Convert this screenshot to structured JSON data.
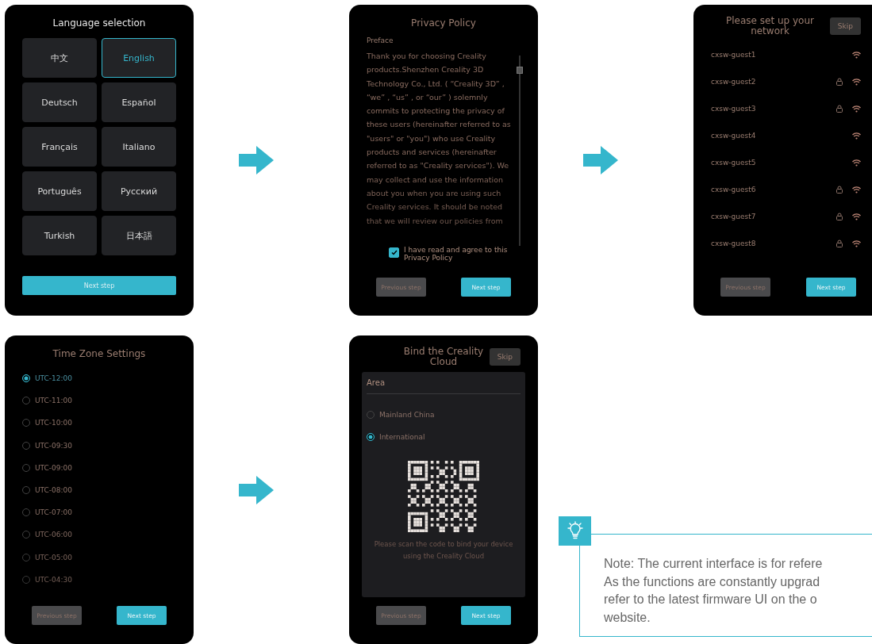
{
  "screens": [
    {
      "kind": "language",
      "title": "Language selection",
      "languages": [
        {
          "label": "中文",
          "selected": false
        },
        {
          "label": "English",
          "selected": true
        },
        {
          "label": "Deutsch",
          "selected": false
        },
        {
          "label": "Español",
          "selected": false
        },
        {
          "label": "Français",
          "selected": false
        },
        {
          "label": "Italiano",
          "selected": false
        },
        {
          "label": "Português",
          "selected": false
        },
        {
          "label": "Русский",
          "selected": false
        },
        {
          "label": "Turkish",
          "selected": false
        },
        {
          "label": "日本語",
          "selected": false
        }
      ],
      "next_button": "Next step"
    },
    {
      "kind": "privacy",
      "title": "Privacy Policy",
      "heading": "Preface",
      "body": "Thank you for choosing Creality products.Shenzhen Creality 3D Technology Co., Ltd. ( “Creality 3D” , “we” , “us” , or “our” ) solemnly commits to protecting the privacy of these users (hereinafter referred to as \"users\" or \"you\") who use Creality products and services (hereinafter referred to as \"Creality services\"). We may collect and use the information about you when you are using such Creality services. It should be noted that we will review our policies from",
      "agree": {
        "label": "I have read and agree to this Privacy Policy",
        "checked": true
      },
      "previous_button": "Previous step",
      "next_button": "Next step"
    },
    {
      "kind": "network",
      "title": "Please set up your network",
      "skip_button": "Skip",
      "networks": [
        {
          "name": "cxsw-guest1",
          "locked": false
        },
        {
          "name": "cxsw-guest2",
          "locked": true
        },
        {
          "name": "cxsw-guest3",
          "locked": true
        },
        {
          "name": "cxsw-guest4",
          "locked": false
        },
        {
          "name": "cxsw-guest5",
          "locked": false
        },
        {
          "name": "cxsw-guest6",
          "locked": true
        },
        {
          "name": "cxsw-guest7",
          "locked": true
        },
        {
          "name": "cxsw-guest8",
          "locked": true
        }
      ],
      "previous_button": "Previous step",
      "next_button": "Next step"
    },
    {
      "kind": "timezone",
      "title": "Time Zone Settings",
      "zones": [
        {
          "label": "UTC-12:00",
          "selected": true
        },
        {
          "label": "UTC-11:00",
          "selected": false
        },
        {
          "label": "UTC-10:00",
          "selected": false
        },
        {
          "label": "UTC-09:30",
          "selected": false
        },
        {
          "label": "UTC-09:00",
          "selected": false
        },
        {
          "label": "UTC-08:00",
          "selected": false
        },
        {
          "label": "UTC-07:00",
          "selected": false
        },
        {
          "label": "UTC-06:00",
          "selected": false
        },
        {
          "label": "UTC-05:00",
          "selected": false
        },
        {
          "label": "UTC-04:30",
          "selected": false
        }
      ],
      "previous_button": "Previous step",
      "next_button": "Next step"
    },
    {
      "kind": "cloud",
      "title": "Bind the Creality Cloud",
      "skip_button": "Skip",
      "area_label": "Area",
      "areas": [
        {
          "label": "Mainland China",
          "selected": false
        },
        {
          "label": "International",
          "selected": true
        }
      ],
      "qr_caption": "Please scan the code to bind your device using the Creality Cloud",
      "previous_button": "Previous step",
      "next_button": "Next step"
    }
  ],
  "note": {
    "text": "Note: The current interface is for refere\nAs the functions are constantly upgrad\nrefer to the latest firmware UI on the o\nwebsite."
  }
}
